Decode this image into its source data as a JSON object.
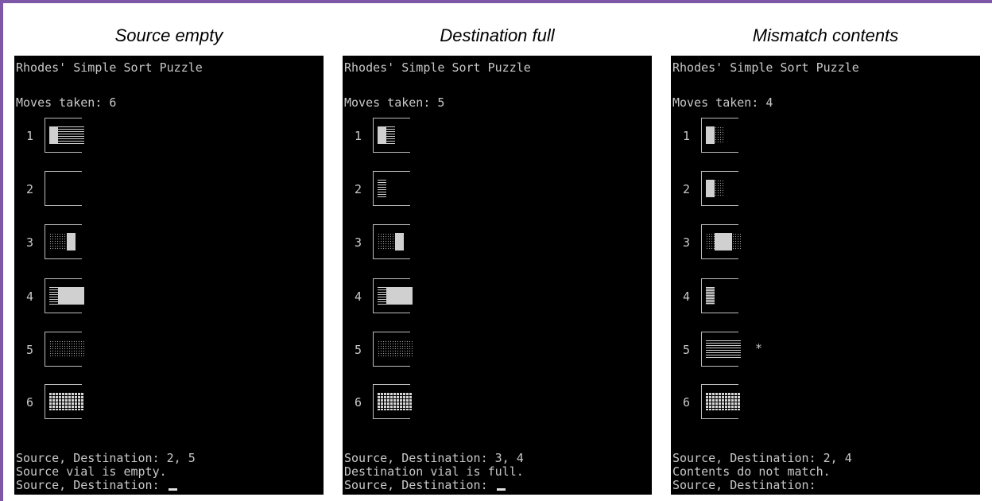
{
  "panels": [
    {
      "caption": "Source empty",
      "title": "Rhodes' Simple Sort Puzzle",
      "moves": "Moves taken: 6",
      "vials": [
        {
          "num": "1",
          "segments": [
            {
              "color": "white",
              "units": 1
            },
            {
              "color": "dash",
              "units": 3
            }
          ],
          "marker": ""
        },
        {
          "num": "2",
          "segments": [],
          "marker": ""
        },
        {
          "num": "3",
          "segments": [
            {
              "color": "dots",
              "units": 2
            },
            {
              "color": "white",
              "units": 1
            }
          ],
          "marker": ""
        },
        {
          "num": "4",
          "segments": [
            {
              "color": "dash",
              "units": 1
            },
            {
              "color": "white",
              "units": 3
            }
          ],
          "marker": ""
        },
        {
          "num": "5",
          "segments": [
            {
              "color": "dots",
              "units": 4
            }
          ],
          "marker": ""
        },
        {
          "num": "6",
          "segments": [
            {
              "color": "grid",
              "units": 4
            }
          ],
          "marker": ""
        }
      ],
      "prompt1": "Source, Destination: 2, 5",
      "message": "Source vial is empty.",
      "prompt2": "Source, Destination: ",
      "cursor": true
    },
    {
      "caption": "Destination full",
      "title": "Rhodes' Simple Sort Puzzle",
      "moves": "Moves taken: 5",
      "vials": [
        {
          "num": "1",
          "segments": [
            {
              "color": "white",
              "units": 1
            },
            {
              "color": "dash",
              "units": 1
            }
          ],
          "marker": ""
        },
        {
          "num": "2",
          "segments": [
            {
              "color": "dash",
              "units": 1
            }
          ],
          "marker": ""
        },
        {
          "num": "3",
          "segments": [
            {
              "color": "dots",
              "units": 2
            },
            {
              "color": "white",
              "units": 1
            }
          ],
          "marker": ""
        },
        {
          "num": "4",
          "segments": [
            {
              "color": "dash",
              "units": 1
            },
            {
              "color": "white",
              "units": 3
            }
          ],
          "marker": ""
        },
        {
          "num": "5",
          "segments": [
            {
              "color": "dots",
              "units": 4
            }
          ],
          "marker": ""
        },
        {
          "num": "6",
          "segments": [
            {
              "color": "grid",
              "units": 4
            }
          ],
          "marker": ""
        }
      ],
      "prompt1": "Source, Destination: 3, 4",
      "message": "Destination vial is full.",
      "prompt2": "Source, Destination: ",
      "cursor": true
    },
    {
      "caption": "Mismatch contents",
      "title": "Rhodes' Simple Sort Puzzle",
      "moves": "Moves taken: 4",
      "vials": [
        {
          "num": "1",
          "segments": [
            {
              "color": "white",
              "units": 1
            },
            {
              "color": "dots",
              "units": 1
            }
          ],
          "marker": ""
        },
        {
          "num": "2",
          "segments": [
            {
              "color": "white",
              "units": 1
            },
            {
              "color": "dots",
              "units": 1
            }
          ],
          "marker": ""
        },
        {
          "num": "3",
          "segments": [
            {
              "color": "dots",
              "units": 1
            },
            {
              "color": "white",
              "units": 2
            },
            {
              "color": "dots",
              "units": 1
            }
          ],
          "marker": ""
        },
        {
          "num": "4",
          "segments": [
            {
              "color": "hatch",
              "units": 1
            }
          ],
          "marker": ""
        },
        {
          "num": "5",
          "segments": [
            {
              "color": "dash",
              "units": 4
            }
          ],
          "marker": "*"
        },
        {
          "num": "6",
          "segments": [
            {
              "color": "grid",
              "units": 4
            }
          ],
          "marker": ""
        }
      ],
      "prompt1": "Source, Destination: 2, 4",
      "message": "Contents do not match.",
      "prompt2": "Source, Destination:",
      "cursor": false
    }
  ]
}
